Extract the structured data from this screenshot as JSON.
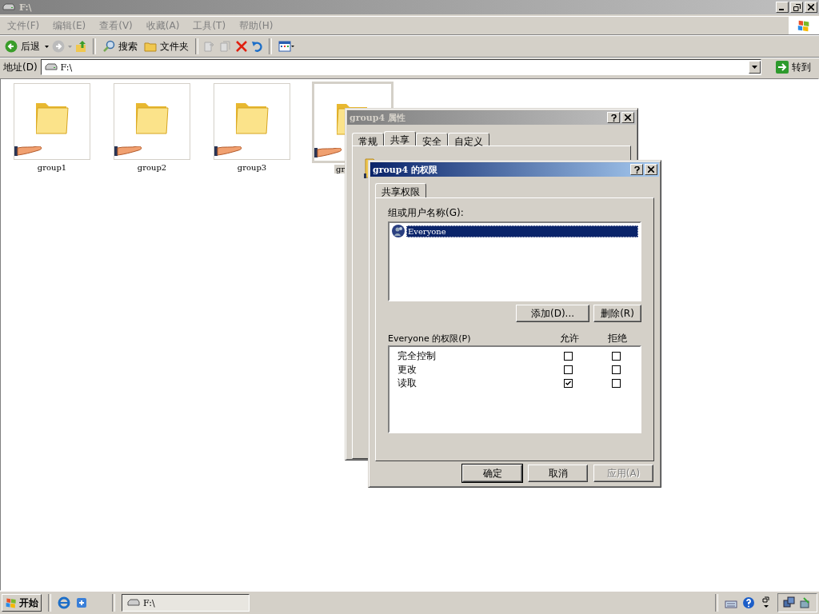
{
  "window": {
    "title": "F:\\"
  },
  "menu": [
    {
      "label": "文件(F)"
    },
    {
      "label": "编辑(E)"
    },
    {
      "label": "查看(V)"
    },
    {
      "label": "收藏(A)"
    },
    {
      "label": "工具(T)"
    },
    {
      "label": "帮助(H)"
    }
  ],
  "toolbar": {
    "back": "后退",
    "search": "搜索",
    "folders": "文件夹"
  },
  "address": {
    "label": "地址(D)",
    "value": "F:\\",
    "go": "转到"
  },
  "folders": [
    {
      "name": "group1",
      "selected": false
    },
    {
      "name": "group2",
      "selected": false
    },
    {
      "name": "group3",
      "selected": false
    },
    {
      "name": "gr",
      "selected": true
    }
  ],
  "properties_dialog": {
    "title": "group4 属性",
    "tabs": [
      {
        "label": "常规",
        "selected": false
      },
      {
        "label": "共享",
        "selected": true
      },
      {
        "label": "安全",
        "selected": false
      },
      {
        "label": "自定义",
        "selected": false
      }
    ]
  },
  "permissions_dialog": {
    "title": "group4 的权限",
    "tab": "共享权限",
    "group_label": "组或用户名称(G):",
    "users": [
      {
        "name": "Everyone",
        "selected": true
      }
    ],
    "add": "添加(D)...",
    "remove": "删除(R)",
    "perm_label": "Everyone 的权限(P)",
    "allow": "允许",
    "deny": "拒绝",
    "permissions": [
      {
        "name": "完全控制",
        "allow": false,
        "deny": false
      },
      {
        "name": "更改",
        "allow": false,
        "deny": false
      },
      {
        "name": "读取",
        "allow": true,
        "deny": false
      }
    ],
    "buttons": [
      {
        "label": "确定",
        "disabled": false
      },
      {
        "label": "取消",
        "disabled": false
      },
      {
        "label": "应用(A)",
        "disabled": true
      }
    ]
  },
  "taskbar": {
    "start": "开始",
    "task": "F:\\"
  }
}
